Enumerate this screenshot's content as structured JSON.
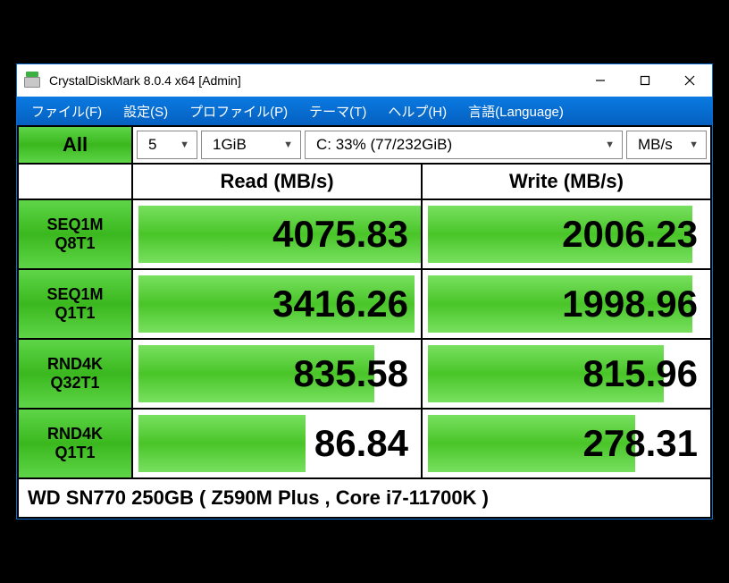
{
  "window": {
    "title": "CrystalDiskMark 8.0.4 x64 [Admin]"
  },
  "menu": {
    "file": "ファイル(F)",
    "settings": "設定(S)",
    "profile": "プロファイル(P)",
    "theme": "テーマ(T)",
    "help": "ヘルプ(H)",
    "language": "言語(Language)"
  },
  "toolbar": {
    "all_label": "All",
    "count": "5",
    "size": "1GiB",
    "drive": "C: 33% (77/232GiB)",
    "unit": "MB/s"
  },
  "headers": {
    "read": "Read (MB/s)",
    "write": "Write (MB/s)"
  },
  "tests": [
    {
      "label1": "SEQ1M",
      "label2": "Q8T1",
      "read": "4075.83",
      "write": "2006.23",
      "read_pct": 98,
      "write_pct": 92
    },
    {
      "label1": "SEQ1M",
      "label2": "Q1T1",
      "read": "3416.26",
      "write": "1998.96",
      "read_pct": 96,
      "write_pct": 92
    },
    {
      "label1": "RND4K",
      "label2": "Q32T1",
      "read": "835.58",
      "write": "815.96",
      "read_pct": 82,
      "write_pct": 82
    },
    {
      "label1": "RND4K",
      "label2": "Q1T1",
      "read": "86.84",
      "write": "278.31",
      "read_pct": 58,
      "write_pct": 72
    }
  ],
  "footer": {
    "text": "WD SN770 250GB ( Z590M Plus , Core i7-11700K )"
  }
}
